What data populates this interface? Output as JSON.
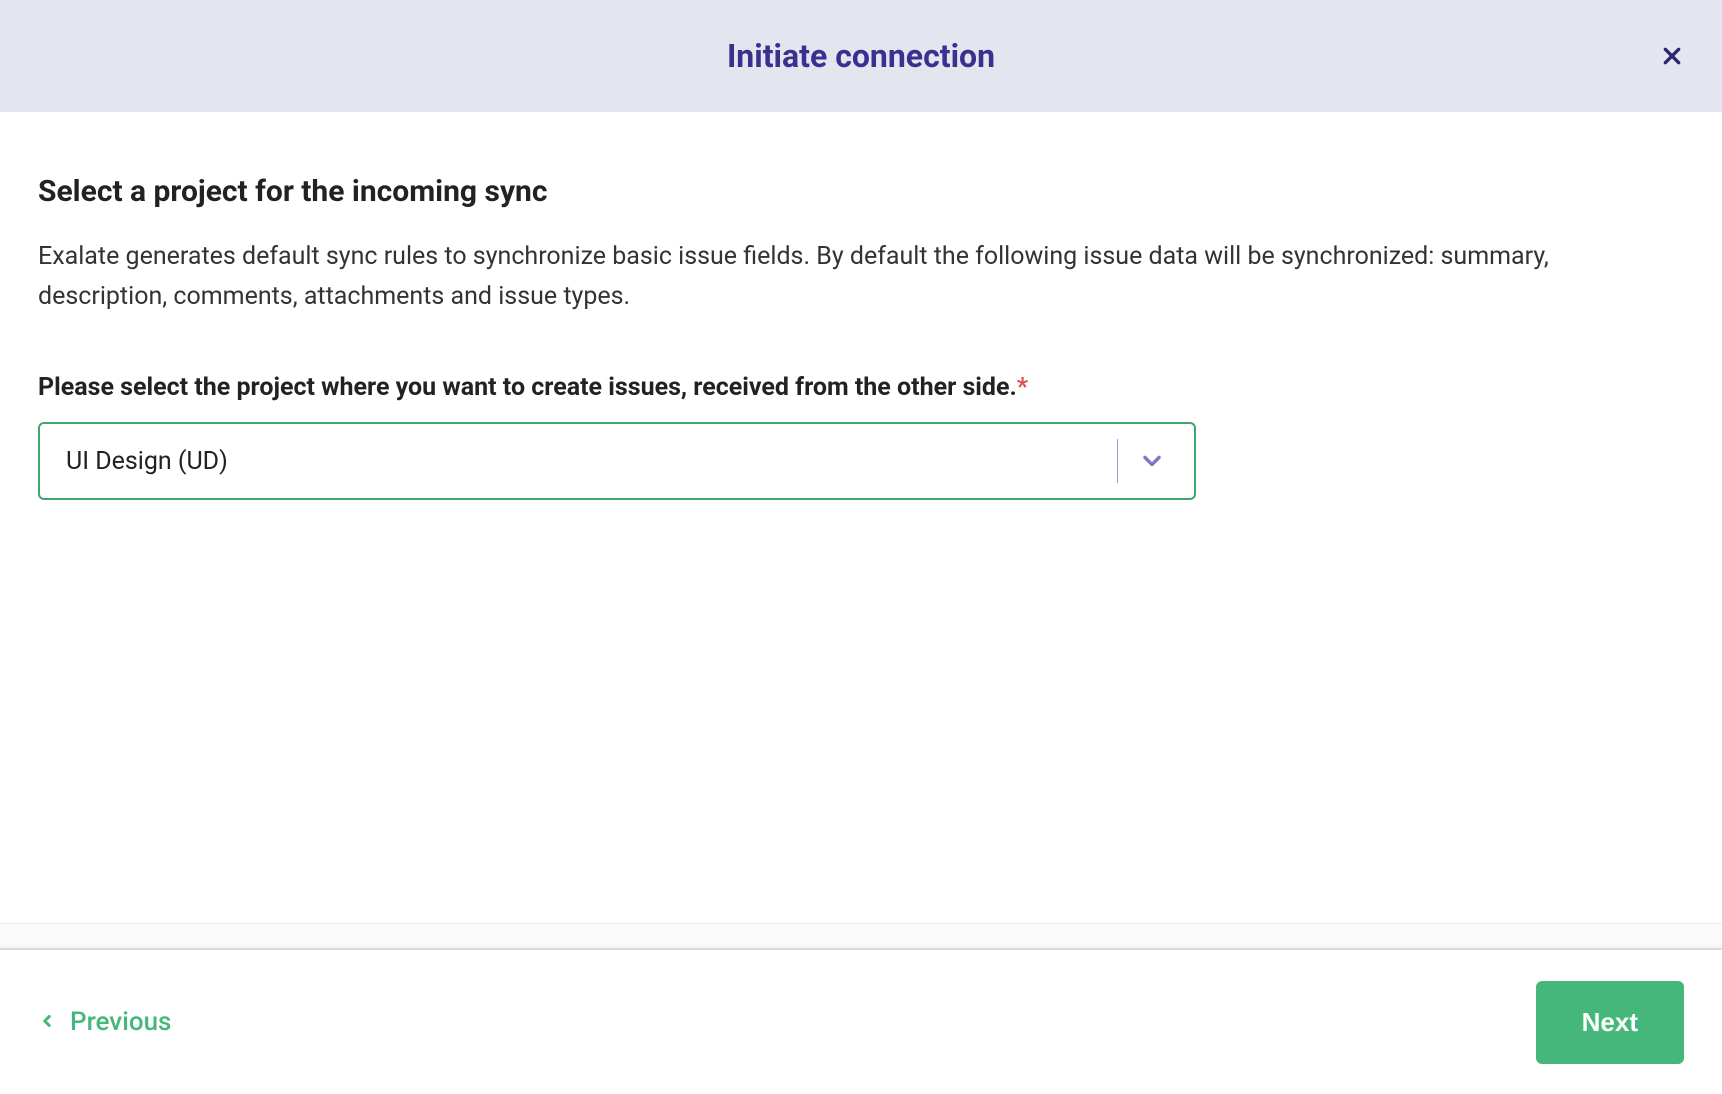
{
  "header": {
    "title": "Initiate connection"
  },
  "main": {
    "heading": "Select a project for the incoming sync",
    "description": "Exalate generates default sync rules to synchronize basic issue fields. By default the following issue data will be synchronized: summary, description, comments, attachments and issue types.",
    "field_label": "Please select the project where you want to create issues, received from the other side.",
    "required_marker": "*",
    "project_select": {
      "selected_value": "UI Design (UD)"
    }
  },
  "footer": {
    "previous_label": "Previous",
    "next_label": "Next"
  }
}
